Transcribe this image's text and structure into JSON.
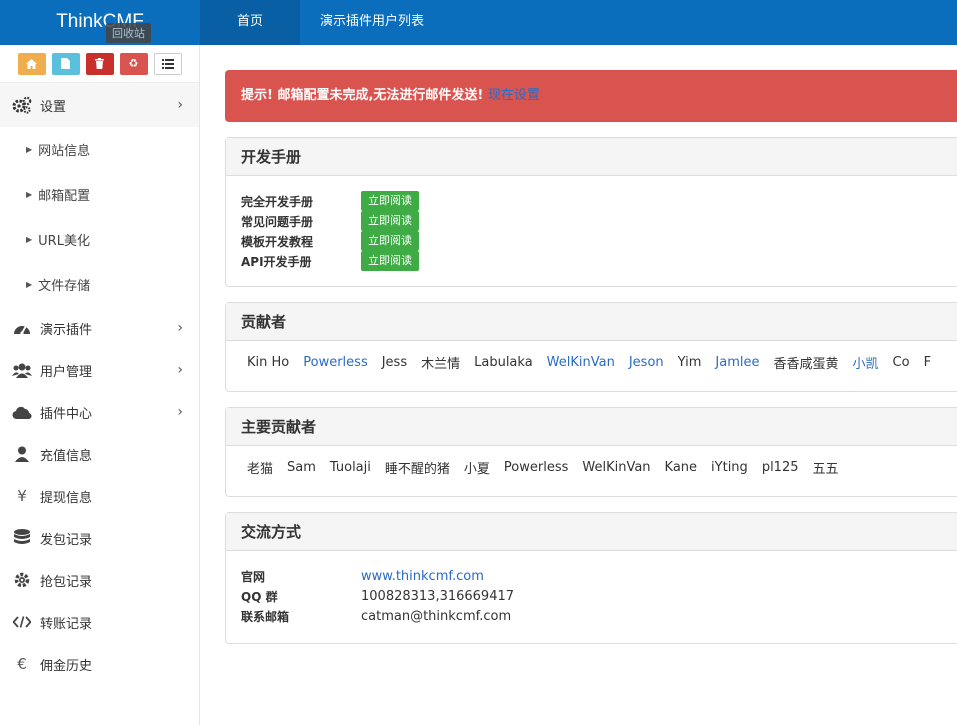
{
  "header": {
    "brand": "ThinkCMF",
    "tabs": [
      {
        "label": "首页"
      },
      {
        "label": "演示插件用户列表"
      }
    ]
  },
  "shortcuts": {
    "tooltip": "回收站",
    "buttons": [
      {
        "icon": "home-icon",
        "color": "#f0ad4e"
      },
      {
        "icon": "file-icon",
        "color": "#5bc0de"
      },
      {
        "icon": "trash-icon",
        "color": "#c9302c"
      },
      {
        "icon": "recycle-icon",
        "color": "#d9534f"
      },
      {
        "icon": "list-icon",
        "color": "#ffffff"
      }
    ]
  },
  "sidebar": {
    "settings": {
      "label": "设置",
      "children": [
        "网站信息",
        "邮箱配置",
        "URL美化",
        "文件存储"
      ]
    },
    "items": [
      {
        "label": "演示插件",
        "icon": "dashboard-icon",
        "has_children": true
      },
      {
        "label": "用户管理",
        "icon": "users-icon",
        "has_children": true
      },
      {
        "label": "插件中心",
        "icon": "cloud-icon",
        "has_children": true
      },
      {
        "label": "充值信息",
        "icon": "user-icon",
        "has_children": false
      },
      {
        "label": "提现信息",
        "icon": "yen-icon",
        "has_children": false
      },
      {
        "label": "发包记录",
        "icon": "database-icon",
        "has_children": false
      },
      {
        "label": "抢包记录",
        "icon": "gear-icon",
        "has_children": false
      },
      {
        "label": "转账记录",
        "icon": "code-icon",
        "has_children": false
      },
      {
        "label": "佣金历史",
        "icon": "euro-icon",
        "has_children": false
      }
    ]
  },
  "alert": {
    "prefix": "提示! ",
    "text": "邮箱配置未完成,无法进行邮件发送! ",
    "link": "现在设置"
  },
  "dev_manual": {
    "title": "开发手册",
    "rows": [
      {
        "label": "完全开发手册",
        "badge": "立即阅读"
      },
      {
        "label": "常见问题手册",
        "badge": "立即阅读"
      },
      {
        "label": "模板开发教程",
        "badge": "立即阅读"
      },
      {
        "label": "API开发手册",
        "badge": "立即阅读"
      }
    ]
  },
  "contributors": {
    "title": "贡献者",
    "names": [
      {
        "name": "Kin Ho",
        "link": false
      },
      {
        "name": "Powerless",
        "link": true
      },
      {
        "name": "Jess",
        "link": false
      },
      {
        "name": "木兰情",
        "link": false
      },
      {
        "name": "Labulaka",
        "link": false
      },
      {
        "name": "WelKinVan",
        "link": true
      },
      {
        "name": "Jeson",
        "link": true
      },
      {
        "name": "Yim",
        "link": false
      },
      {
        "name": "Jamlee",
        "link": true
      },
      {
        "name": "香香咸蛋黄",
        "link": false
      },
      {
        "name": "小凯",
        "link": true
      },
      {
        "name": "Co",
        "link": false
      },
      {
        "name": "F",
        "link": false
      }
    ]
  },
  "main_contributors": {
    "title": "主要贡献者",
    "names": [
      "老猫",
      "Sam",
      "Tuolaji",
      "睡不醒的猪",
      "小夏",
      "Powerless",
      "WelKinVan",
      "Kane",
      "iYting",
      "pl125",
      "五五"
    ]
  },
  "contact": {
    "title": "交流方式",
    "rows": [
      {
        "label": "官网",
        "value": "www.thinkcmf.com",
        "link": true
      },
      {
        "label": "QQ 群",
        "value": "100828313,316669417",
        "link": false
      },
      {
        "label": "联系邮箱",
        "value": "catman@thinkcmf.com",
        "link": false
      }
    ]
  }
}
